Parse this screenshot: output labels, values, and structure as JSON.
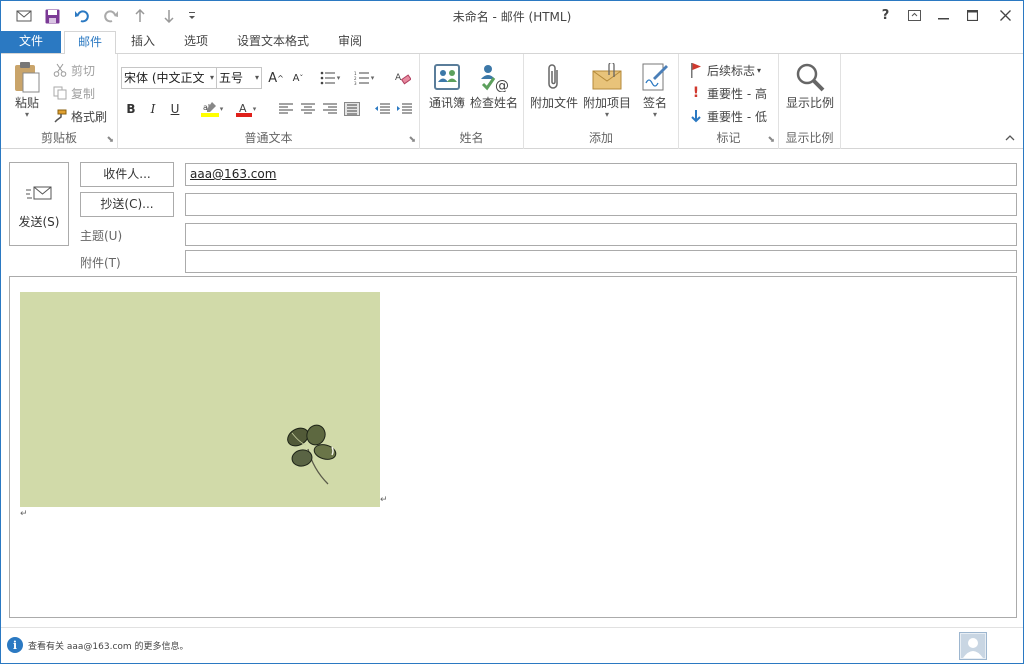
{
  "window": {
    "title": "未命名 - 邮件 (HTML)",
    "help": "?",
    "ribbon_display": "⊡",
    "minimize": "—",
    "maximize": "☐",
    "close": "✕"
  },
  "qat": {
    "icons": [
      "send-receive-icon",
      "save-icon",
      "undo-icon",
      "redo-icon",
      "up-icon",
      "down-icon",
      "customize-icon"
    ]
  },
  "tabs": [
    "文件",
    "邮件",
    "插入",
    "选项",
    "设置文本格式",
    "审阅"
  ],
  "ribbon": {
    "clipboard": {
      "label": "剪贴板",
      "paste": "粘贴",
      "cut": "剪切",
      "copy": "复制",
      "format_painter": "格式刷"
    },
    "basic_text": {
      "label": "普通文本",
      "font": "宋体 (中文正文",
      "size": "五号",
      "grow": "A",
      "shrink": "A",
      "bold": "B",
      "italic": "I",
      "underline": "U",
      "font_color": "A"
    },
    "names": {
      "label": "姓名",
      "address_book": "通讯簿",
      "check_names": "检查姓名"
    },
    "include": {
      "label": "添加",
      "attach_file": "附加文件",
      "attach_item": "附加项目",
      "signature": "签名"
    },
    "tags": {
      "label": "标记",
      "follow_up": "后续标志",
      "high": "重要性 - 高",
      "low": "重要性 - 低"
    },
    "zoom": {
      "label": "显示比例",
      "zoom_btn": "显示比例"
    }
  },
  "header": {
    "send": "发送(S)",
    "to_btn": "收件人...",
    "cc_btn": "抄送(C)...",
    "subject_label": "主题(U)",
    "attach_label": "附件(T)",
    "to_value": "aaa@163.com",
    "cc_value": "",
    "subject_value": "",
    "attach_value": ""
  },
  "body": {
    "para_mark": "↵"
  },
  "status": {
    "info": "查看有关 aaa@163.com 的更多信息。"
  },
  "colors": {
    "accent": "#2b79c2",
    "image_bg": "#d1daa9",
    "highlight_yellow": "#ffff00",
    "font_red": "#e0201a"
  }
}
